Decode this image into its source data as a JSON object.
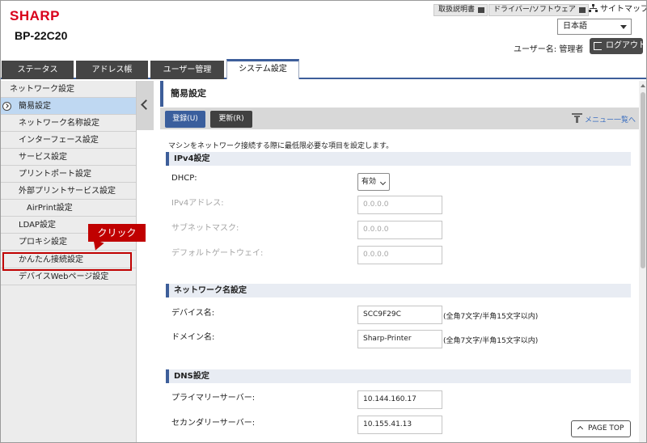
{
  "header": {
    "logo": "SHARP",
    "model": "BP-22C20",
    "links": [
      {
        "label": "取扱説明書"
      },
      {
        "label": "ドライバー/ソフトウェア"
      },
      {
        "label": "サイトマップ"
      }
    ],
    "language": "日本語",
    "user_label": "ユーザー名: 管理者",
    "logout_label": "ログアウト"
  },
  "tabs": [
    {
      "label": "ステータス"
    },
    {
      "label": "アドレス帳"
    },
    {
      "label": "ユーザー管理"
    },
    {
      "label": "システム設定",
      "active": true
    }
  ],
  "sidebar": {
    "items": [
      {
        "label": "ネットワーク設定"
      },
      {
        "label": "簡易設定",
        "selected": true
      },
      {
        "label": "ネットワーク名称設定"
      },
      {
        "label": "インターフェース設定"
      },
      {
        "label": "サービス設定"
      },
      {
        "label": "プリントポート設定"
      },
      {
        "label": "外部プリントサービス設定"
      },
      {
        "label": "AirPrint設定"
      },
      {
        "label": "LDAP設定"
      },
      {
        "label": "プロキシ設定"
      },
      {
        "label": "かんたん接続設定"
      },
      {
        "label": "デバイスWebページ設定"
      }
    ],
    "callout": "クリック"
  },
  "main": {
    "title": "簡易設定",
    "register_button": "登録(U)",
    "update_button": "更新(R)",
    "menu_link": "メニュー一覧へ",
    "intro": "マシンをネットワーク接続する際に最低限必要な項目を設定します。",
    "ipv4": {
      "heading": "IPv4設定",
      "dhcp_label": "DHCP:",
      "dhcp_value": "有効",
      "ip_label": "IPv4アドレス:",
      "ip_value": "0.0.0.0",
      "mask_label": "サブネットマスク:",
      "mask_value": "0.0.0.0",
      "gateway_label": "デフォルトゲートウェイ:",
      "gateway_value": "0.0.0.0"
    },
    "network_name": {
      "heading": "ネットワーク名設定",
      "device_label": "デバイス名:",
      "device_value": "SCC9F29C",
      "device_hint": "(全角7文字/半角15文字以内)",
      "domain_label": "ドメイン名:",
      "domain_value": "Sharp-Printer",
      "domain_hint": "(全角7文字/半角15文字以内)"
    },
    "dns": {
      "heading": "DNS設定",
      "primary_label": "プライマリーサーバー:",
      "primary_value": "10.144.160.17",
      "secondary_label": "セカンダリーサーバー:",
      "secondary_value": "10.155.41.13"
    },
    "page_top": "PAGE TOP"
  },
  "colors": {
    "brand": "#d9001b",
    "accent": "#3d5e9a",
    "callout": "#c00000"
  }
}
